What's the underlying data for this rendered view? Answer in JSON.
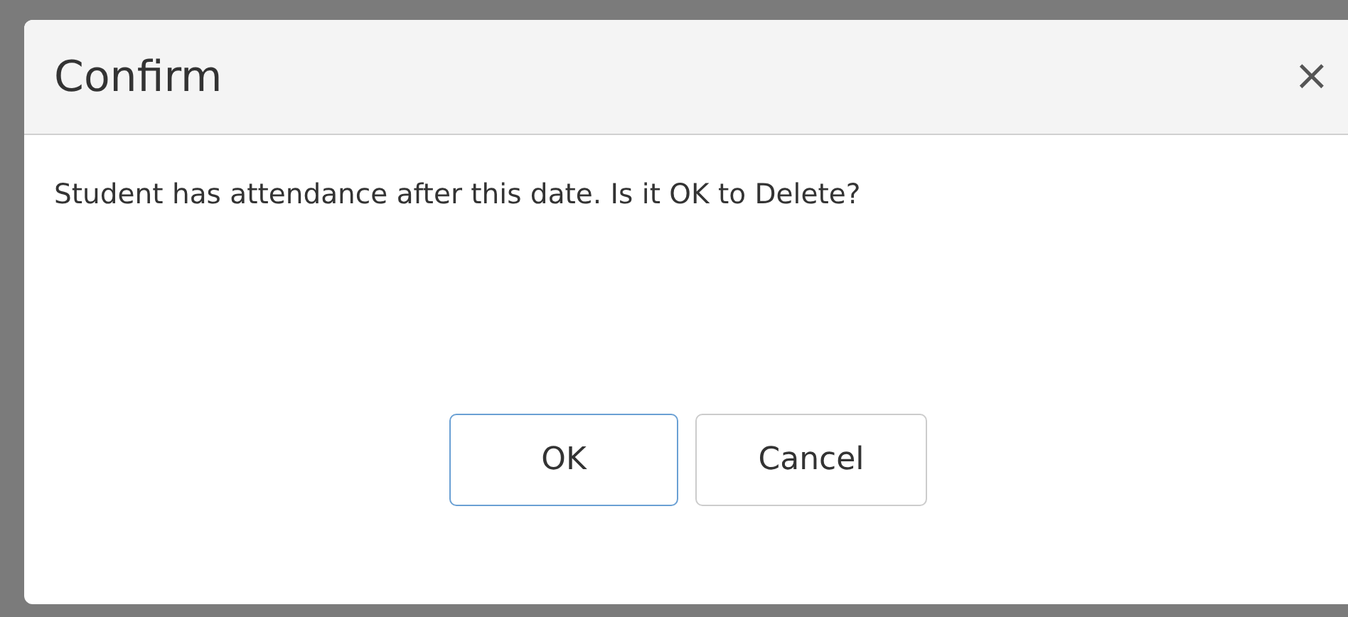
{
  "dialog": {
    "title": "Confirm",
    "close_icon": "×",
    "message": "Student has attendance after this date. Is it OK to Delete?",
    "buttons": [
      {
        "label": "OK",
        "focused": true
      },
      {
        "label": "Cancel",
        "focused": false
      }
    ]
  }
}
